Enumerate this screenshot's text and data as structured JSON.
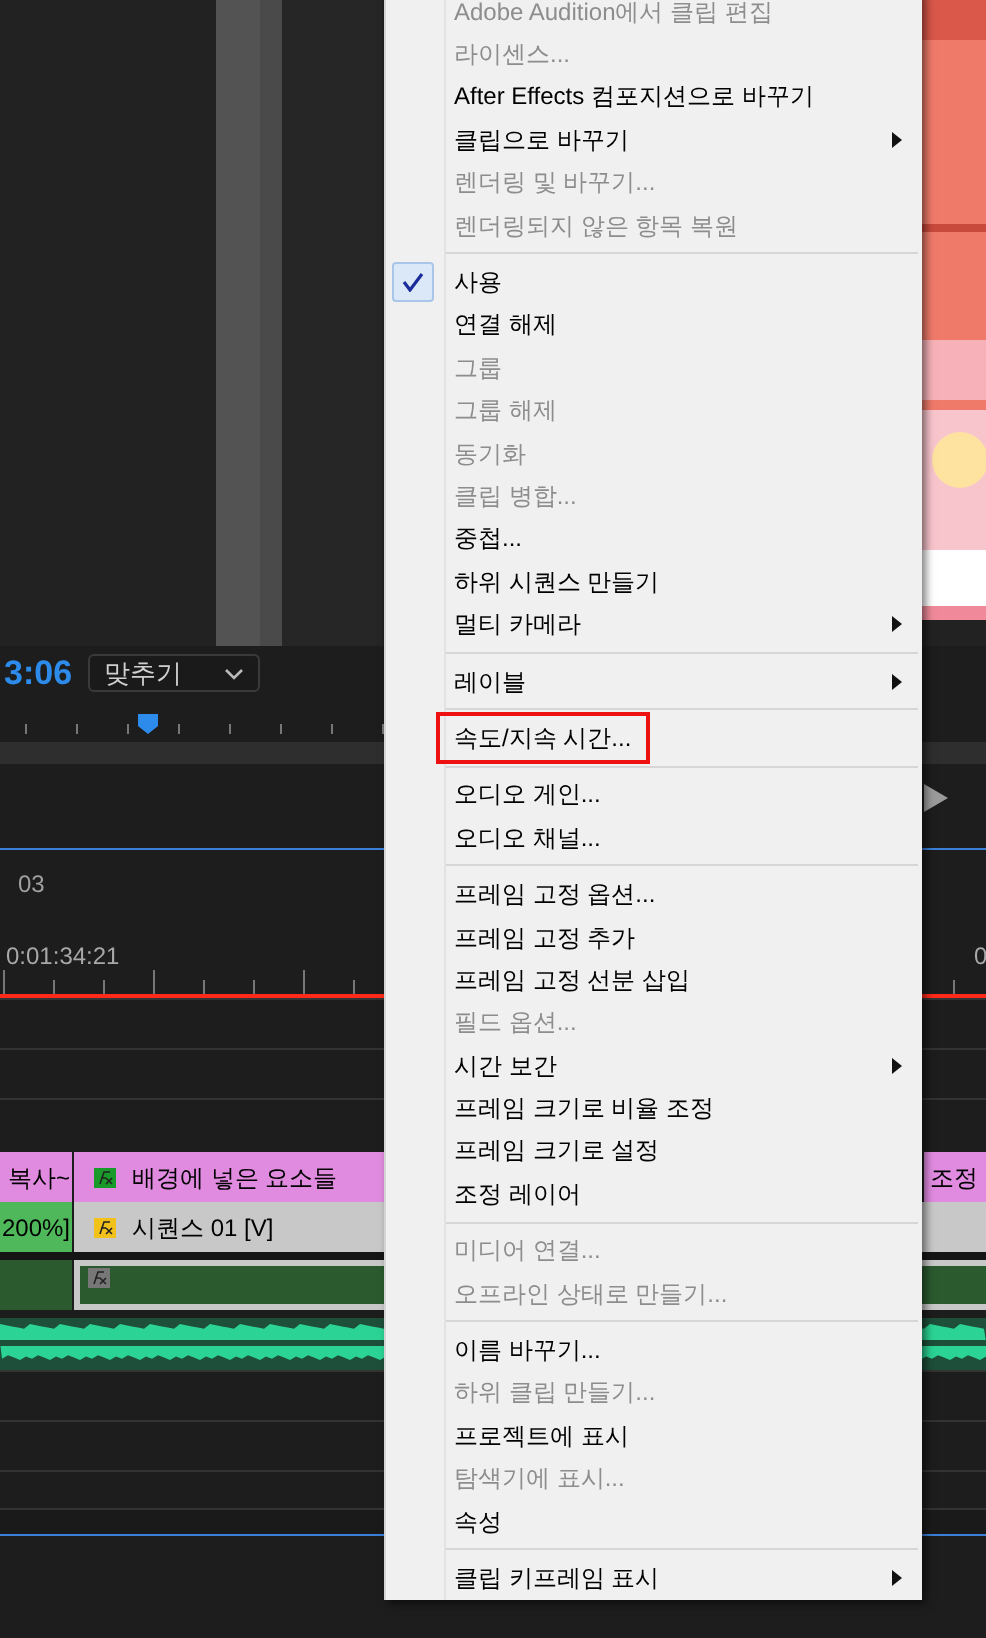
{
  "monitor": {
    "kind": "picture",
    "timecode": "3:06",
    "zoom_dropdown": {
      "value": "맞추기"
    }
  },
  "timeline": {
    "sequence_tab": "03",
    "timecode": "0:01:34:21",
    "ruler_label": "0",
    "video_track_2": [
      {
        "label": "복사~",
        "color": "#e08be0"
      },
      {
        "label": "배경에 넣은 요소들",
        "fx": true,
        "color": "#e08be0"
      },
      {
        "label": "조정",
        "fx": false,
        "color": "#e08be0"
      }
    ],
    "video_track_1": [
      {
        "label": "200%]",
        "color": "#4fb85a"
      },
      {
        "label": "시퀀스 01 [V]",
        "fx": true,
        "color": "#c8c8c8"
      }
    ]
  },
  "context_menu": {
    "groups": [
      [
        {
          "label": "Adobe Audition에서 클립 편집",
          "disabled": true,
          "checked": false,
          "submenu": false,
          "highlighted": false
        },
        {
          "label": "라이센스...",
          "disabled": true,
          "checked": false,
          "submenu": false,
          "highlighted": false
        },
        {
          "label": "After Effects 컴포지션으로 바꾸기",
          "disabled": false,
          "checked": false,
          "submenu": false,
          "highlighted": false
        },
        {
          "label": "클립으로 바꾸기",
          "disabled": false,
          "checked": false,
          "submenu": true,
          "highlighted": false
        },
        {
          "label": "렌더링 및 바꾸기...",
          "disabled": true,
          "checked": false,
          "submenu": false,
          "highlighted": false
        },
        {
          "label": "렌더링되지 않은 항목 복원",
          "disabled": true,
          "checked": false,
          "submenu": false,
          "highlighted": false
        }
      ],
      [
        {
          "label": "사용",
          "disabled": false,
          "checked": true,
          "submenu": false,
          "highlighted": false
        },
        {
          "label": "연결 해제",
          "disabled": false,
          "checked": false,
          "submenu": false,
          "highlighted": false
        },
        {
          "label": "그룹",
          "disabled": true,
          "checked": false,
          "submenu": false,
          "highlighted": false
        },
        {
          "label": "그룹 해제",
          "disabled": true,
          "checked": false,
          "submenu": false,
          "highlighted": false
        },
        {
          "label": "동기화",
          "disabled": true,
          "checked": false,
          "submenu": false,
          "highlighted": false
        },
        {
          "label": "클립 병합...",
          "disabled": true,
          "checked": false,
          "submenu": false,
          "highlighted": false
        },
        {
          "label": "중첩...",
          "disabled": false,
          "checked": false,
          "submenu": false,
          "highlighted": false
        },
        {
          "label": "하위 시퀀스 만들기",
          "disabled": false,
          "checked": false,
          "submenu": false,
          "highlighted": false
        },
        {
          "label": "멀티 카메라",
          "disabled": false,
          "checked": false,
          "submenu": true,
          "highlighted": false
        }
      ],
      [
        {
          "label": "레이블",
          "disabled": false,
          "checked": false,
          "submenu": true,
          "highlighted": false
        }
      ],
      [
        {
          "label": "속도/지속 시간...",
          "disabled": false,
          "checked": false,
          "submenu": false,
          "highlighted": true
        }
      ],
      [
        {
          "label": "오디오 게인...",
          "disabled": false,
          "checked": false,
          "submenu": false,
          "highlighted": false
        },
        {
          "label": "오디오 채널...",
          "disabled": false,
          "checked": false,
          "submenu": false,
          "highlighted": false
        }
      ],
      [
        {
          "label": "프레임 고정 옵션...",
          "disabled": false,
          "checked": false,
          "submenu": false,
          "highlighted": false
        },
        {
          "label": "프레임 고정 추가",
          "disabled": false,
          "checked": false,
          "submenu": false,
          "highlighted": false
        },
        {
          "label": "프레임 고정 선분 삽입",
          "disabled": false,
          "checked": false,
          "submenu": false,
          "highlighted": false
        },
        {
          "label": "필드 옵션...",
          "disabled": true,
          "checked": false,
          "submenu": false,
          "highlighted": false
        },
        {
          "label": "시간 보간",
          "disabled": false,
          "checked": false,
          "submenu": true,
          "highlighted": false
        },
        {
          "label": "프레임 크기로 비율 조정",
          "disabled": false,
          "checked": false,
          "submenu": false,
          "highlighted": false
        },
        {
          "label": "프레임 크기로 설정",
          "disabled": false,
          "checked": false,
          "submenu": false,
          "highlighted": false
        },
        {
          "label": "조정 레이어",
          "disabled": false,
          "checked": false,
          "submenu": false,
          "highlighted": false
        }
      ],
      [
        {
          "label": "미디어 연결...",
          "disabled": true,
          "checked": false,
          "submenu": false,
          "highlighted": false
        },
        {
          "label": "오프라인 상태로 만들기...",
          "disabled": true,
          "checked": false,
          "submenu": false,
          "highlighted": false
        }
      ],
      [
        {
          "label": "이름 바꾸기...",
          "disabled": false,
          "checked": false,
          "submenu": false,
          "highlighted": false
        },
        {
          "label": "하위 클립 만들기...",
          "disabled": true,
          "checked": false,
          "submenu": false,
          "highlighted": false
        },
        {
          "label": "프로젝트에 표시",
          "disabled": false,
          "checked": false,
          "submenu": false,
          "highlighted": false
        },
        {
          "label": "탐색기에 표시...",
          "disabled": true,
          "checked": false,
          "submenu": false,
          "highlighted": false
        },
        {
          "label": "속성",
          "disabled": false,
          "checked": false,
          "submenu": false,
          "highlighted": false
        }
      ],
      [
        {
          "label": "클립 키프레임 표시",
          "disabled": false,
          "checked": false,
          "submenu": true,
          "highlighted": false
        }
      ]
    ]
  }
}
